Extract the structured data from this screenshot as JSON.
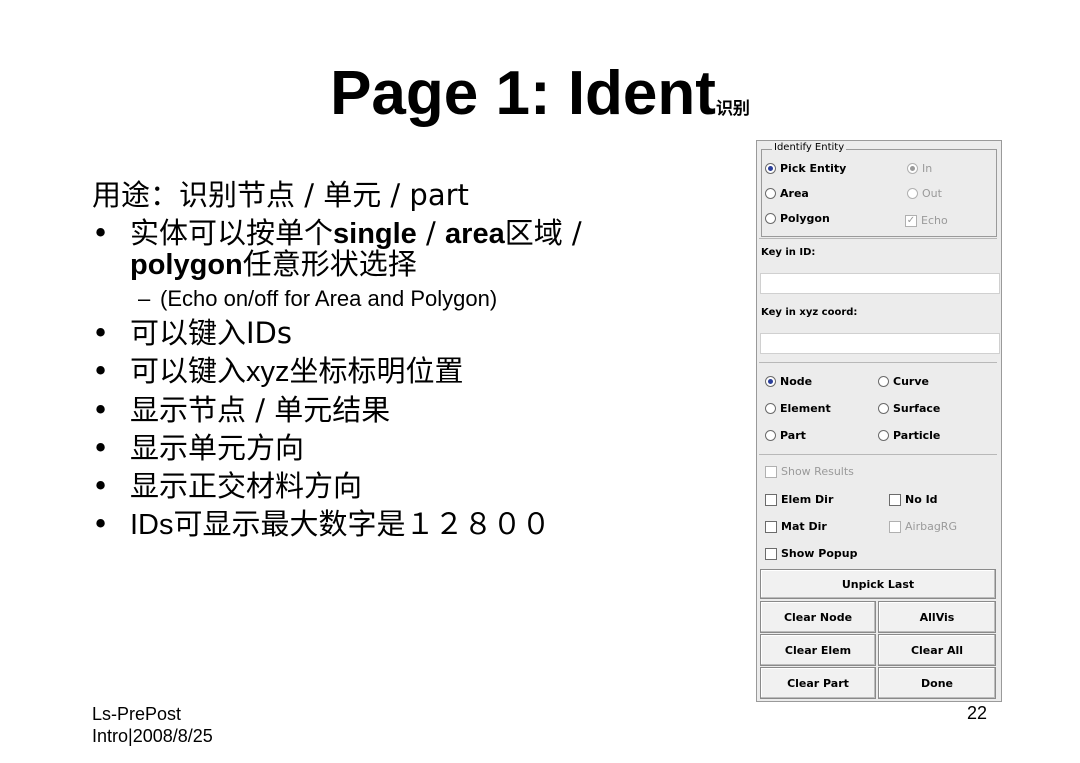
{
  "title": {
    "main": "Page 1: Ident",
    "sub": "识别"
  },
  "content": {
    "intro": "用途：识别节点 / 单元 / part",
    "bullet1_a": "实体可以按单个",
    "bullet1_b": "single",
    "bullet1_c": " / ",
    "bullet1_d": "area",
    "bullet1_e": "区域 /",
    "bullet1_f": "polygon",
    "bullet1_g": "任意形状选择",
    "sub1": "(Echo on/off for Area and Polygon)",
    "bullet2": "可以键入IDs",
    "bullet3_a": "可以键入",
    "bullet3_b": "xyz",
    "bullet3_c": "坐标标明位置",
    "bullet4": "显示节点 / 单元结果",
    "bullet5": "显示单元方向",
    "bullet6": "显示正交材料方向",
    "bullet7_a": "IDs",
    "bullet7_b": "可显示最大数字是１２８００",
    "bullet_char": "•",
    "dash_char": "–"
  },
  "footer": {
    "left_1": "Ls-PrePost",
    "left_2": "Intro|2008/8/25",
    "page": "22"
  },
  "panel": {
    "group_title": "Identify Entity",
    "pick_entity": "Pick Entity",
    "area": "Area",
    "polygon": "Polygon",
    "in": "In",
    "out": "Out",
    "echo": "Echo",
    "key_id_label": "Key in ID:",
    "key_id_value": "",
    "key_xyz_label": "Key in xyz coord:",
    "key_xyz_value": "",
    "node": "Node",
    "element": "Element",
    "part": "Part",
    "curve": "Curve",
    "surface": "Surface",
    "particle": "Particle",
    "show_results": "Show Results",
    "elem_dir": "Elem Dir",
    "no_id": "No Id",
    "mat_dir": "Mat Dir",
    "airbag_rg": "AirbagRG",
    "show_popup": "Show Popup",
    "unpick_last": "Unpick Last",
    "clear_node": "Clear Node",
    "allvis": "AllVis",
    "clear_elem": "Clear Elem",
    "clear_all": "Clear All",
    "clear_part": "Clear Part",
    "done": "Done",
    "check_mark": "✓"
  }
}
